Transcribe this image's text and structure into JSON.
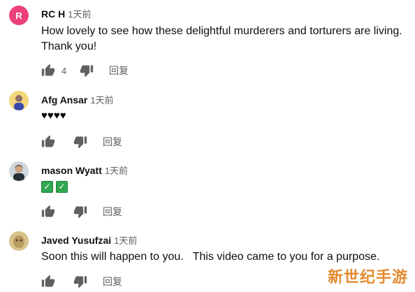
{
  "comments": [
    {
      "author": "RC H",
      "time": "1天前",
      "avatar_letter": "R",
      "avatar_color": "#ec407a",
      "text_lines": [
        "How lovely to see how these delightful murderers and torturers are living.",
        "Thank you!"
      ],
      "likes": "4",
      "reply": "回复"
    },
    {
      "author": "Afg Ansar",
      "time": "1天前",
      "avatar_color": "#f2d77a",
      "text": "♥♥♥♥",
      "likes": "",
      "reply": "回复"
    },
    {
      "author": "mason Wyatt",
      "time": "1天前",
      "avatar_color": "#cfd8dc",
      "text": "✅✅",
      "likes": "",
      "reply": "回复"
    },
    {
      "author": "Javed Yusufzai",
      "time": "1天前",
      "avatar_color": "#d8c38a",
      "text": "Soon this will happen to you.   This video came to you for a purpose.",
      "likes": "",
      "reply": "回复"
    }
  ],
  "watermark": "新世纪手游",
  "icon_color": "#606060"
}
